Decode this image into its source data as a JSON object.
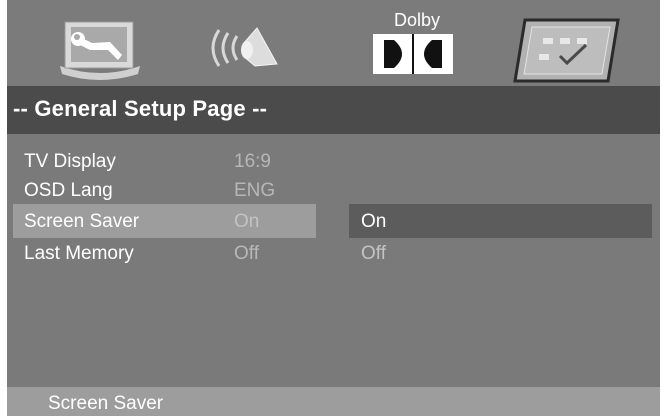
{
  "tabs": [
    {
      "name": "general-setup",
      "icon": "wrench-icon",
      "selected": false
    },
    {
      "name": "audio-setup",
      "icon": "speaker-icon",
      "selected": false
    },
    {
      "name": "dolby-setup",
      "icon": "dolby-icon",
      "label": "Dolby",
      "selected": false
    },
    {
      "name": "preference-setup",
      "icon": "checklist-icon",
      "selected": true
    }
  ],
  "header": {
    "title": "-- General Setup Page --"
  },
  "settings": [
    {
      "label": "TV Display",
      "value": "16:9"
    },
    {
      "label": "OSD Lang",
      "value": "ENG"
    },
    {
      "label": "Screen Saver",
      "value": "On",
      "selected": true
    },
    {
      "label": "Last Memory",
      "value": "Off"
    }
  ],
  "options": [
    {
      "label": "On",
      "selected": true
    },
    {
      "label": "Off",
      "selected": false
    }
  ],
  "status": {
    "text": "Screen Saver"
  },
  "colors": {
    "background": "#7a7a7a",
    "title_bar": "#4b4b4b",
    "selected_row": "#9d9d9d",
    "selected_option": "#5c5c5c",
    "status_bar": "#9d9d9d"
  }
}
